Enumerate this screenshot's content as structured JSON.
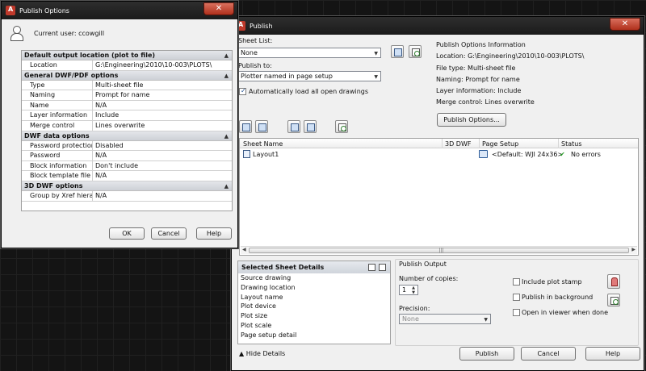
{
  "options_dialog": {
    "title": "Publish Options",
    "close_label": "✕",
    "current_user": "Current user: ccowgill",
    "sections": [
      {
        "title": "Default output location (plot to file)",
        "rows": [
          {
            "k": "Location",
            "v": "G:\\Engineering\\2010\\10-003\\PLOTS\\"
          }
        ]
      },
      {
        "title": "General DWF/PDF options",
        "rows": [
          {
            "k": "Type",
            "v": "Multi-sheet file"
          },
          {
            "k": "Naming",
            "v": "Prompt for name"
          },
          {
            "k": "Name",
            "v": "N/A"
          },
          {
            "k": "Layer information",
            "v": "Include"
          },
          {
            "k": "Merge control",
            "v": "Lines overwrite"
          }
        ]
      },
      {
        "title": "DWF data options",
        "rows": [
          {
            "k": "Password protection",
            "v": "Disabled"
          },
          {
            "k": "Password",
            "v": "N/A"
          },
          {
            "k": "Block information",
            "v": "Don't include"
          },
          {
            "k": "Block template file",
            "v": "N/A"
          }
        ]
      },
      {
        "title": "3D DWF options",
        "rows": [
          {
            "k": "Group by Xref hiera...",
            "v": "N/A"
          }
        ]
      }
    ],
    "ok_label": "OK",
    "cancel_label": "Cancel",
    "help_label": "Help"
  },
  "publish_dialog": {
    "title": "Publish",
    "close_label": "✕",
    "sheet_list_label": "Sheet List:",
    "sheet_list_value": "None",
    "publish_to_label": "Publish to:",
    "publish_to_value": "Plotter named in page setup",
    "auto_load_label": "Automatically load all open drawings",
    "auto_load_checked": true,
    "info_title": "Publish Options Information",
    "info_lines": [
      "Location: G:\\Engineering\\2010\\10-003\\PLOTS\\",
      "File type: Multi-sheet file",
      "Naming: Prompt for name",
      "Layer information: Include",
      "Merge control: Lines overwrite"
    ],
    "publish_options_button": "Publish Options...",
    "columns": [
      "Sheet Name",
      "3D DWF",
      "Page Setup",
      "Status"
    ],
    "sheets": [
      {
        "name": "Layout1",
        "page_setup": "<Default: WJI 24x36>",
        "status": "No errors"
      }
    ],
    "details_title": "Selected Sheet Details",
    "details_items": [
      "Source drawing",
      "Drawing location",
      "Layout name",
      "Plot device",
      "Plot size",
      "Plot scale",
      "Page setup detail"
    ],
    "output_title": "Publish Output",
    "copies_label": "Number of copies:",
    "copies_value": "1",
    "precision_label": "Precision:",
    "precision_value": "None",
    "include_stamp_label": "Include plot stamp",
    "background_label": "Publish in background",
    "viewer_label": "Open in viewer when done",
    "hide_details_label": "Hide Details",
    "publish_label": "Publish",
    "cancel_label": "Cancel",
    "help_label": "Help"
  }
}
